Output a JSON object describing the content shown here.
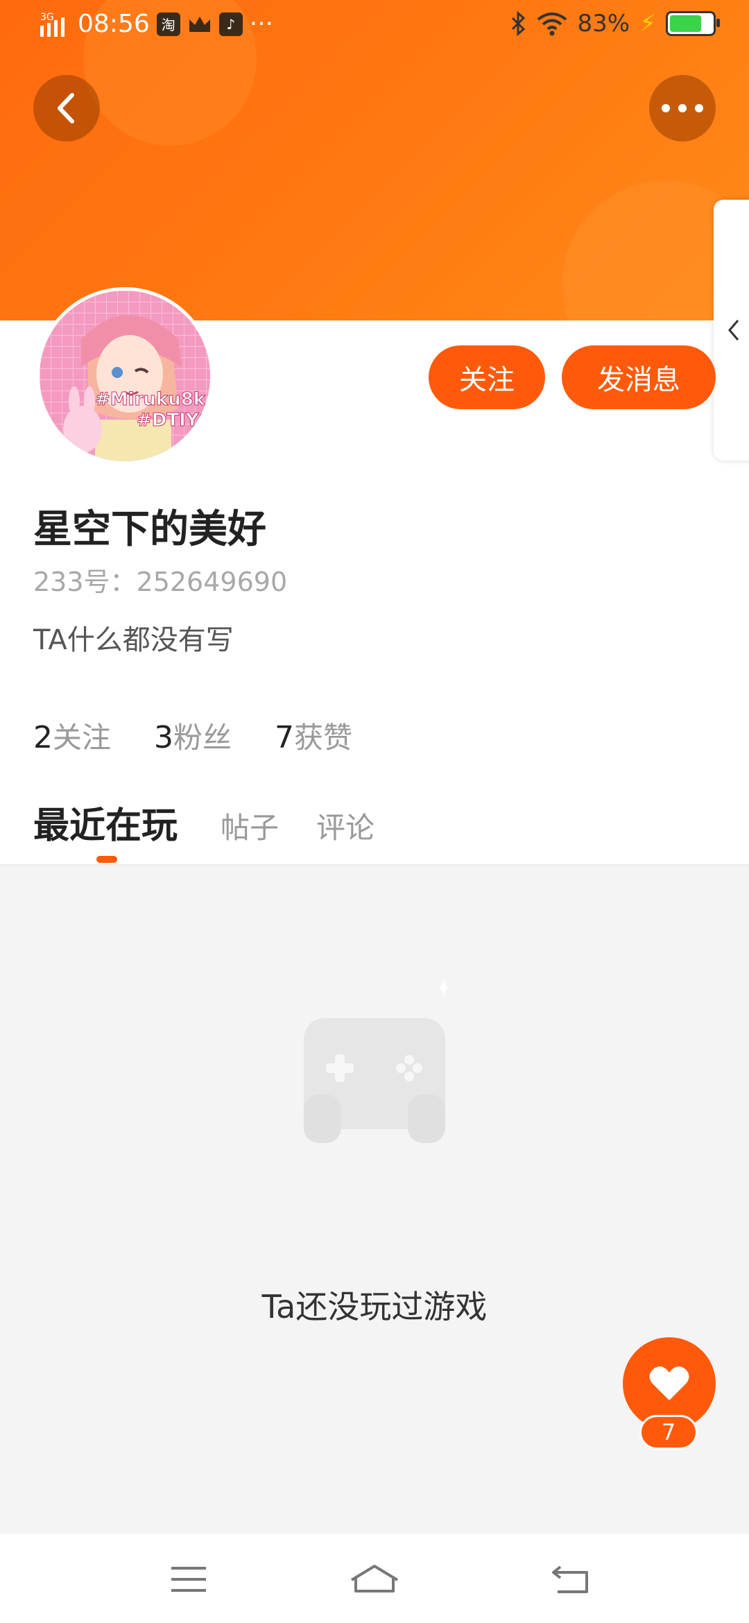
{
  "status_bar": {
    "network": "3G",
    "time": "08:56",
    "taobao_badge": "淘",
    "more_dots": "···",
    "battery": "83%",
    "battery_level": 0.83
  },
  "profile": {
    "username": "星空下的美好",
    "uid": "233号：252649690",
    "bio": "TA什么都没有写",
    "avatar_text": [
      "#Miruku8k",
      "#DTIYS"
    ]
  },
  "actions": {
    "follow": "关注",
    "message": "发消息"
  },
  "stats": [
    {
      "num": "2",
      "label": "关注"
    },
    {
      "num": "3",
      "label": "粉丝"
    },
    {
      "num": "7",
      "label": "获赞"
    }
  ],
  "tabs": [
    {
      "label": "最近在玩",
      "active": true
    },
    {
      "label": "帖子"
    },
    {
      "label": "评论"
    }
  ],
  "empty_state": {
    "icon": "gamepad-icon",
    "text": "Ta还没玩过游戏"
  },
  "like": {
    "count": "7"
  },
  "colors": {
    "accent": "#ff5a0b",
    "header": "#ff7a12"
  }
}
